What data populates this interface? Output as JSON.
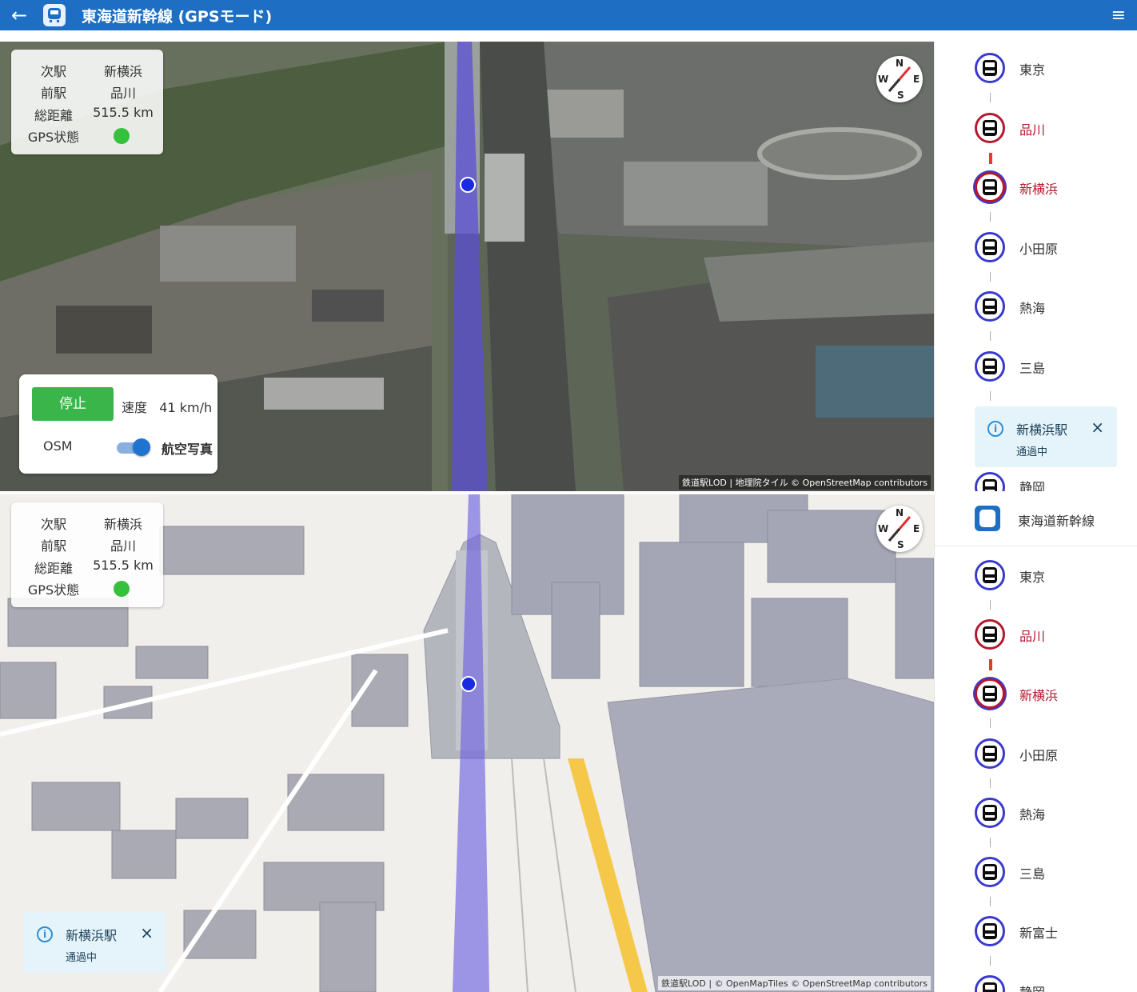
{
  "appbar": {
    "back_icon": "←",
    "title": "東海道新幹線 (GPSモード)",
    "menu_icon": "≡"
  },
  "top": {
    "info": {
      "next_label": "次駅",
      "next_value": "新横浜",
      "prev_label": "前駅",
      "prev_value": "品川",
      "dist_label": "総距離",
      "dist_value": "515.5 km",
      "gps_label": "GPS状態"
    },
    "compass": {
      "n": "N",
      "e": "E",
      "s": "S",
      "w": "W"
    },
    "control": {
      "stop_label": "停止",
      "speed_label": "速度",
      "speed_value": "41 km/h",
      "osm_label": "OSM",
      "aerial_label": "航空写真"
    },
    "attribution": "鉄道駅LOD | 地理院タイル © OpenStreetMap contributors"
  },
  "bottom": {
    "info": {
      "next_label": "次駅",
      "next_value": "新横浜",
      "prev_label": "前駅",
      "prev_value": "品川",
      "dist_label": "総距離",
      "dist_value": "515.5 km",
      "gps_label": "GPS状態"
    },
    "compass": {
      "n": "N",
      "e": "E",
      "s": "S",
      "w": "W"
    },
    "toast": {
      "title": "新横浜駅",
      "status": "通過中",
      "close": "×"
    },
    "attribution": "鉄道駅LOD | © OpenMapTiles © OpenStreetMap contributors"
  },
  "sidebar_top": {
    "stations": [
      "東京",
      "品川",
      "新横浜",
      "小田原",
      "熱海",
      "三島"
    ],
    "partial": "静岡",
    "toast": {
      "title": "新横浜駅",
      "status": "通過中",
      "close": "×"
    }
  },
  "sidebar_bottom": {
    "line_name": "東海道新幹線",
    "stations": [
      "東京",
      "品川",
      "新横浜",
      "小田原",
      "熱海",
      "三島",
      "新富士"
    ],
    "partial": "静岡"
  },
  "colors": {
    "accent": "#1e6fc4",
    "gps_ok": "#35c13b",
    "stop": "#39b54a",
    "passed": "#b4182d",
    "route": "#5b4fd6"
  }
}
